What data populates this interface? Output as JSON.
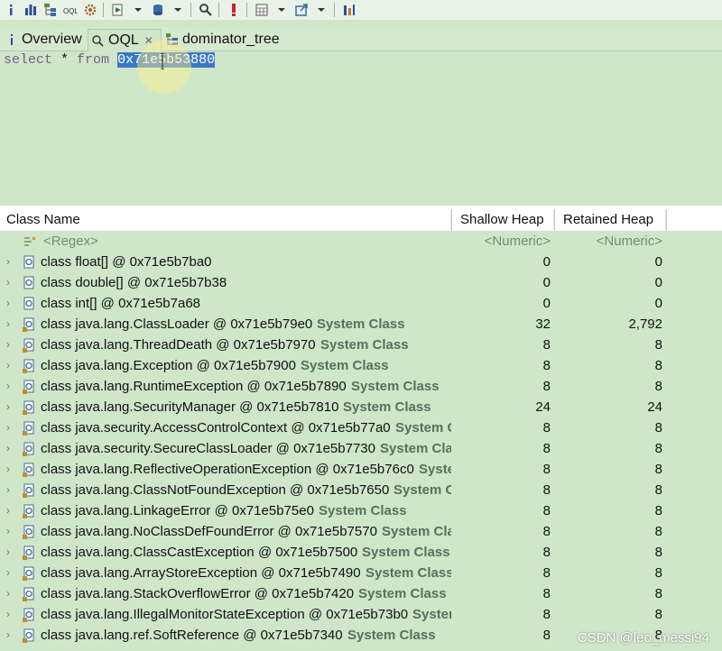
{
  "tabs": [
    {
      "label": "Overview",
      "icon": "info-icon"
    },
    {
      "label": "OQL",
      "icon": "oql-icon",
      "close": "✕"
    },
    {
      "label": "dominator_tree",
      "icon": "tree-icon"
    }
  ],
  "query": {
    "select_kw": "select",
    "star": " * ",
    "from_kw": "from",
    "selected_value": "0x71e5b53880"
  },
  "table": {
    "headers": {
      "name": "Class Name",
      "shallow": "Shallow Heap",
      "retained": "Retained Heap"
    },
    "filter": {
      "name": "<Regex>",
      "shallow": "<Numeric>",
      "retained": "<Numeric>"
    },
    "rows": [
      {
        "name": "class float[] @ 0x71e5b7ba0",
        "sys": "",
        "shallow": "0",
        "retained": "0"
      },
      {
        "name": "class double[] @ 0x71e5b7b38",
        "sys": "",
        "shallow": "0",
        "retained": "0"
      },
      {
        "name": "class int[] @ 0x71e5b7a68",
        "sys": "",
        "shallow": "0",
        "retained": "0"
      },
      {
        "name": "class java.lang.ClassLoader @ 0x71e5b79e0",
        "sys": "System Class",
        "shallow": "32",
        "retained": "2,792"
      },
      {
        "name": "class java.lang.ThreadDeath @ 0x71e5b7970",
        "sys": "System Class",
        "shallow": "8",
        "retained": "8"
      },
      {
        "name": "class java.lang.Exception @ 0x71e5b7900",
        "sys": "System Class",
        "shallow": "8",
        "retained": "8"
      },
      {
        "name": "class java.lang.RuntimeException @ 0x71e5b7890",
        "sys": "System Class",
        "shallow": "8",
        "retained": "8"
      },
      {
        "name": "class java.lang.SecurityManager @ 0x71e5b7810",
        "sys": "System Class",
        "shallow": "24",
        "retained": "24"
      },
      {
        "name": "class java.security.AccessControlContext @ 0x71e5b77a0",
        "sys": "System Class",
        "shallow": "8",
        "retained": "8"
      },
      {
        "name": "class java.security.SecureClassLoader @ 0x71e5b7730",
        "sys": "System Class",
        "shallow": "8",
        "retained": "8"
      },
      {
        "name": "class java.lang.ReflectiveOperationException @ 0x71e5b76c0",
        "sys": "System Class",
        "shallow": "8",
        "retained": "8"
      },
      {
        "name": "class java.lang.ClassNotFoundException @ 0x71e5b7650",
        "sys": "System Class",
        "shallow": "8",
        "retained": "8"
      },
      {
        "name": "class java.lang.LinkageError @ 0x71e5b75e0",
        "sys": "System Class",
        "shallow": "8",
        "retained": "8"
      },
      {
        "name": "class java.lang.NoClassDefFoundError @ 0x71e5b7570",
        "sys": "System Class",
        "shallow": "8",
        "retained": "8"
      },
      {
        "name": "class java.lang.ClassCastException @ 0x71e5b7500",
        "sys": "System Class",
        "shallow": "8",
        "retained": "8"
      },
      {
        "name": "class java.lang.ArrayStoreException @ 0x71e5b7490",
        "sys": "System Class",
        "shallow": "8",
        "retained": "8"
      },
      {
        "name": "class java.lang.StackOverflowError @ 0x71e5b7420",
        "sys": "System Class",
        "shallow": "8",
        "retained": "8"
      },
      {
        "name": "class java.lang.IllegalMonitorStateException @ 0x71e5b73b0",
        "sys": "System Class",
        "shallow": "8",
        "retained": "8"
      },
      {
        "name": "class java.lang.ref.SoftReference @ 0x71e5b7340",
        "sys": "System Class",
        "shallow": "8",
        "retained": "8"
      }
    ]
  },
  "watermark": "CSDN @leo_messi94",
  "colors": {
    "background": "#cfe6c9",
    "selection": "#3a78c8",
    "system_class": "#5a6f5c"
  }
}
